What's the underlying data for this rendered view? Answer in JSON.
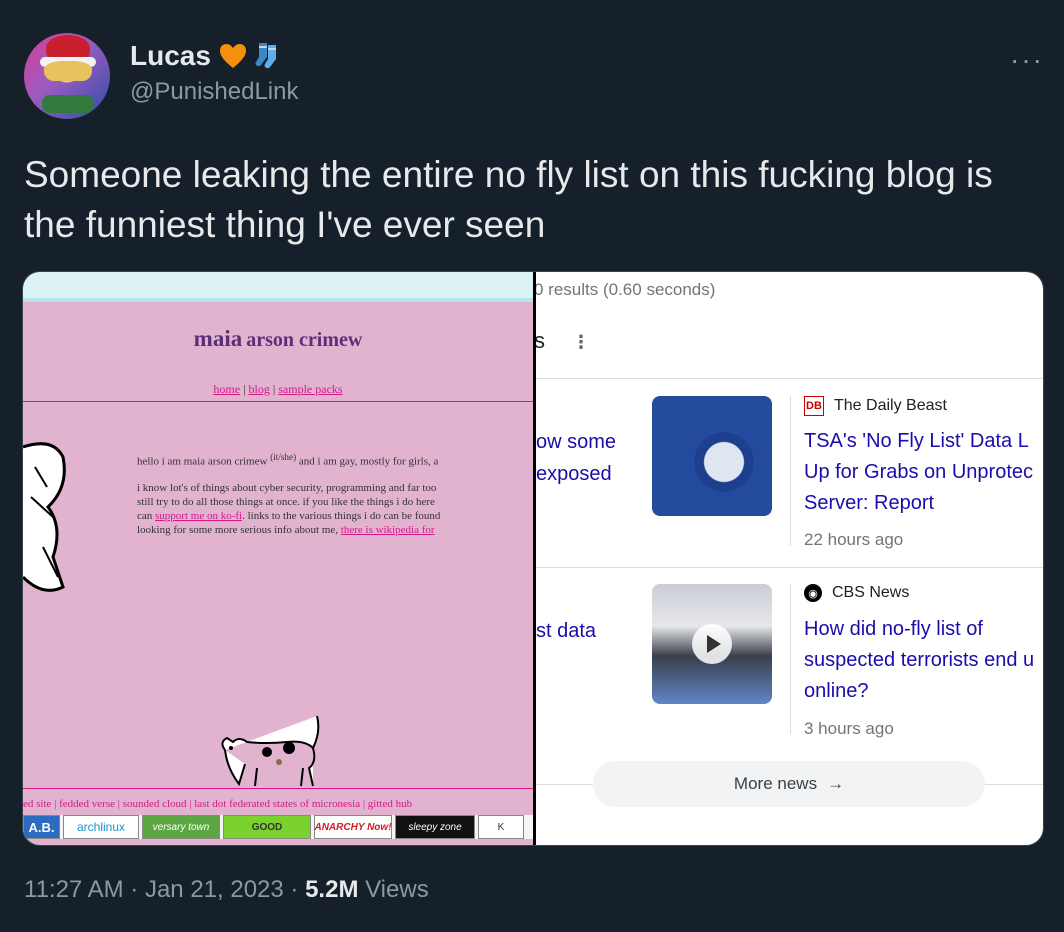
{
  "author": {
    "name": "Lucas",
    "handle": "@PunishedLink"
  },
  "tweet": {
    "text": "Someone leaking the entire no fly list on this fucking blog is the funniest thing I've ever seen"
  },
  "more_label": "···",
  "blog": {
    "title_first": "maia",
    "title_last": "arson crimew",
    "nav": [
      "home",
      "blog",
      "sample packs"
    ],
    "nav_sep": " | ",
    "intro_a": "hello i am maia arson crimew ",
    "pronouns": "(it/she)",
    "intro_b": " and i am gay, mostly for girls, a",
    "para2_line1": "i know lot's of things about cyber security, programming and far too",
    "para2_line2": "still try to do all those things at once. if you like the things i do here",
    "para2_line3a": "can ",
    "kofi_link": "support me on ko-fi",
    "para2_line3b": ". links to the various things i do can be found",
    "para2_line4a": "looking for some more serious info about me, ",
    "wiki_link": "there is wikipedia for",
    "footer_links": "ed site | fedded verse | sounded cloud | last dot federated states of micronesia | gitted hub",
    "badges": [
      "A.B.",
      "archlinux",
      "versary town",
      "GOOD",
      "ANARCHY Now!",
      "sleepy zone",
      "K"
    ]
  },
  "google": {
    "results": "0 results (0.60 seconds)",
    "section_fragment": "s",
    "dots": "⋮",
    "left_text_1_line1": "ow some",
    "left_text_1_line2": "exposed",
    "left_text_2": "st data",
    "articles": [
      {
        "source": "The Daily Beast",
        "logo": "DB",
        "headline_line1": "TSA's 'No Fly List' Data L",
        "headline_line2": "Up for Grabs on Unprotec",
        "headline_line3": "Server: Report",
        "time": "22 hours ago"
      },
      {
        "source": "CBS News",
        "logo": "◉",
        "headline_line1": "How did no-fly list of",
        "headline_line2": "suspected terrorists end u",
        "headline_line3": "online?",
        "time": "3 hours ago"
      }
    ],
    "more_news": "More news",
    "arrow": "→"
  },
  "meta": {
    "time": "11:27 AM",
    "sep": " · ",
    "date": "Jan 21, 2023",
    "views_count": "5.2M",
    "views_label": " Views"
  },
  "colors": {
    "background": "#15202b",
    "blog_pink": "#e1b3cf",
    "link_blue": "#1a0dab"
  }
}
